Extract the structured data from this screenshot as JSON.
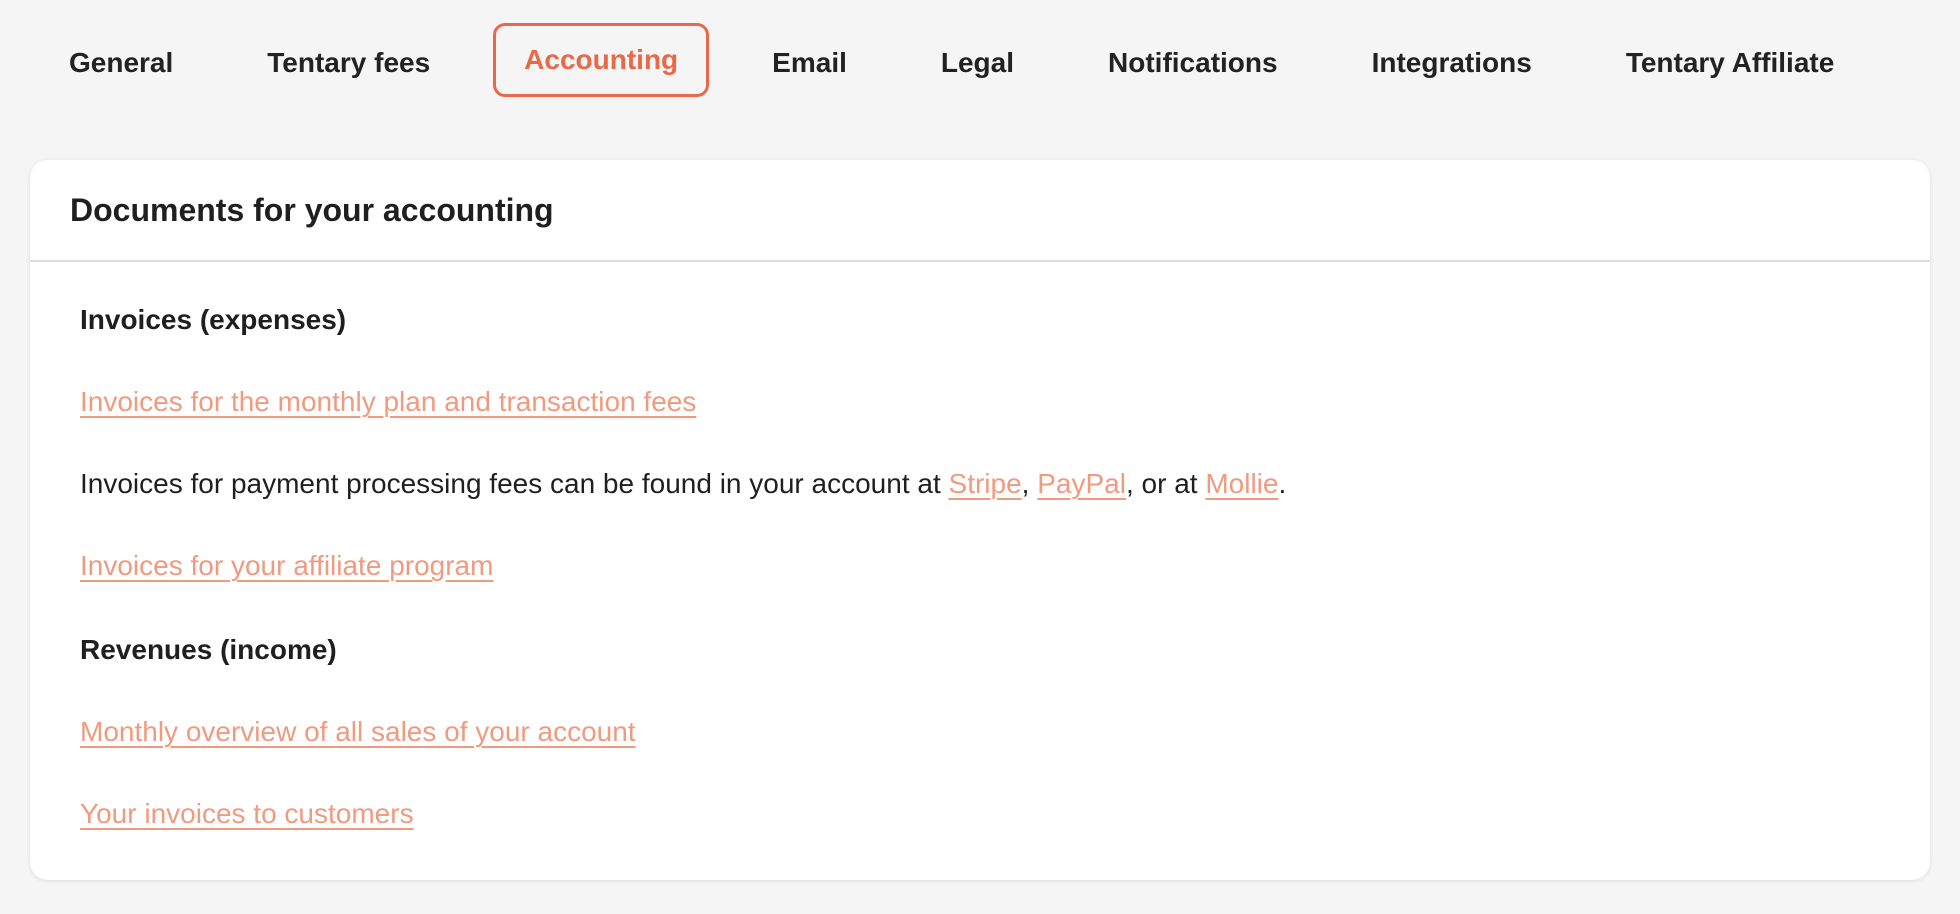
{
  "tabs": [
    {
      "label": "General",
      "active": false
    },
    {
      "label": "Tentary fees",
      "active": false
    },
    {
      "label": "Accounting",
      "active": true
    },
    {
      "label": "Email",
      "active": false
    },
    {
      "label": "Legal",
      "active": false
    },
    {
      "label": "Notifications",
      "active": false
    },
    {
      "label": "Integrations",
      "active": false
    },
    {
      "label": "Tentary Affiliate",
      "active": false
    }
  ],
  "card": {
    "title": "Documents for your accounting",
    "expenses": {
      "heading": "Invoices (expenses)",
      "monthly_plan_link": "Invoices for the monthly plan and transaction fees",
      "processing_text_before": "Invoices for payment processing fees can be found in your account at ",
      "stripe_link": "Stripe",
      "separator_comma": ", ",
      "paypal_link": "PayPal",
      "or_at_text": ", or at ",
      "mollie_link": "Mollie",
      "period": ".",
      "affiliate_link": "Invoices for your affiliate program"
    },
    "income": {
      "heading": "Revenues (income)",
      "sales_overview_link": "Monthly overview of all sales of your account",
      "customer_invoices_link": "Your invoices to customers"
    }
  },
  "colors": {
    "accent": "#e8694a",
    "link": "#f09a80",
    "background": "#f5f5f5",
    "card": "#ffffff"
  }
}
